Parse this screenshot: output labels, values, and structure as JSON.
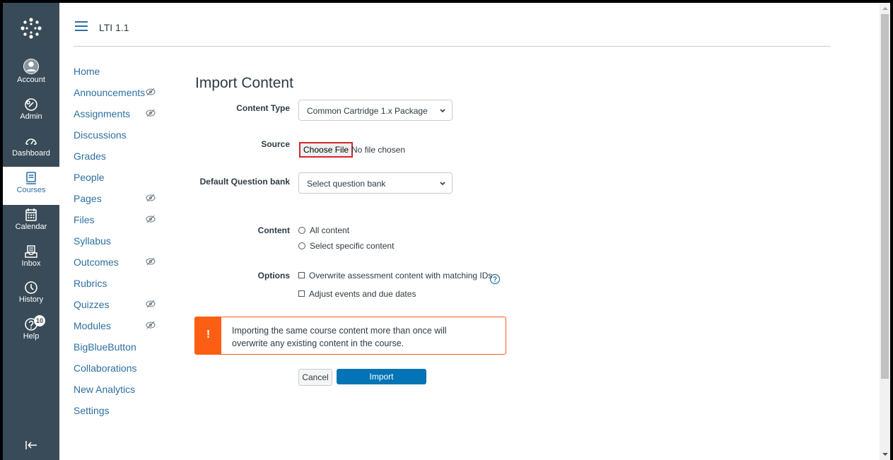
{
  "global_nav": {
    "items": [
      {
        "label": "Account",
        "icon": "account-icon"
      },
      {
        "label": "Admin",
        "icon": "admin-icon"
      },
      {
        "label": "Dashboard",
        "icon": "dashboard-icon"
      },
      {
        "label": "Courses",
        "icon": "courses-icon"
      },
      {
        "label": "Calendar",
        "icon": "calendar-icon"
      },
      {
        "label": "Inbox",
        "icon": "inbox-icon"
      },
      {
        "label": "History",
        "icon": "history-icon"
      },
      {
        "label": "Help",
        "icon": "help-icon"
      }
    ],
    "help_badge": "10",
    "active": "Courses"
  },
  "header": {
    "breadcrumb": "LTI 1.1"
  },
  "course_nav": {
    "items": [
      {
        "label": "Home",
        "hidden": false
      },
      {
        "label": "Announcements",
        "hidden": true
      },
      {
        "label": "Assignments",
        "hidden": true
      },
      {
        "label": "Discussions",
        "hidden": false
      },
      {
        "label": "Grades",
        "hidden": false
      },
      {
        "label": "People",
        "hidden": false
      },
      {
        "label": "Pages",
        "hidden": true
      },
      {
        "label": "Files",
        "hidden": true
      },
      {
        "label": "Syllabus",
        "hidden": false
      },
      {
        "label": "Outcomes",
        "hidden": true
      },
      {
        "label": "Rubrics",
        "hidden": false
      },
      {
        "label": "Quizzes",
        "hidden": true
      },
      {
        "label": "Modules",
        "hidden": true
      },
      {
        "label": "BigBlueButton",
        "hidden": false
      },
      {
        "label": "Collaborations",
        "hidden": false
      },
      {
        "label": "New Analytics",
        "hidden": false
      },
      {
        "label": "Settings",
        "hidden": false
      }
    ]
  },
  "main": {
    "title": "Import Content",
    "content_type_label": "Content Type",
    "content_type_value": "Common Cartridge 1.x Package",
    "source_label": "Source",
    "choose_file_label": "Choose File",
    "no_file_text": "No file chosen",
    "question_bank_label": "Default Question bank",
    "question_bank_value": "Select question bank",
    "content_label": "Content",
    "content_options": [
      "All content",
      "Select specific content"
    ],
    "options_label": "Options",
    "options_checks": [
      "Overwrite assessment content with matching IDs",
      "Adjust events and due dates"
    ],
    "alert_icon": "!",
    "alert_line1": "Importing the same course content more than once will",
    "alert_line2": "overwrite any existing content in the course.",
    "cancel_label": "Cancel",
    "import_label": "Import"
  },
  "colors": {
    "nav_bg": "#394b58",
    "link": "#2d6fa1",
    "primary": "#0374b5",
    "warning": "#fc5e13"
  }
}
